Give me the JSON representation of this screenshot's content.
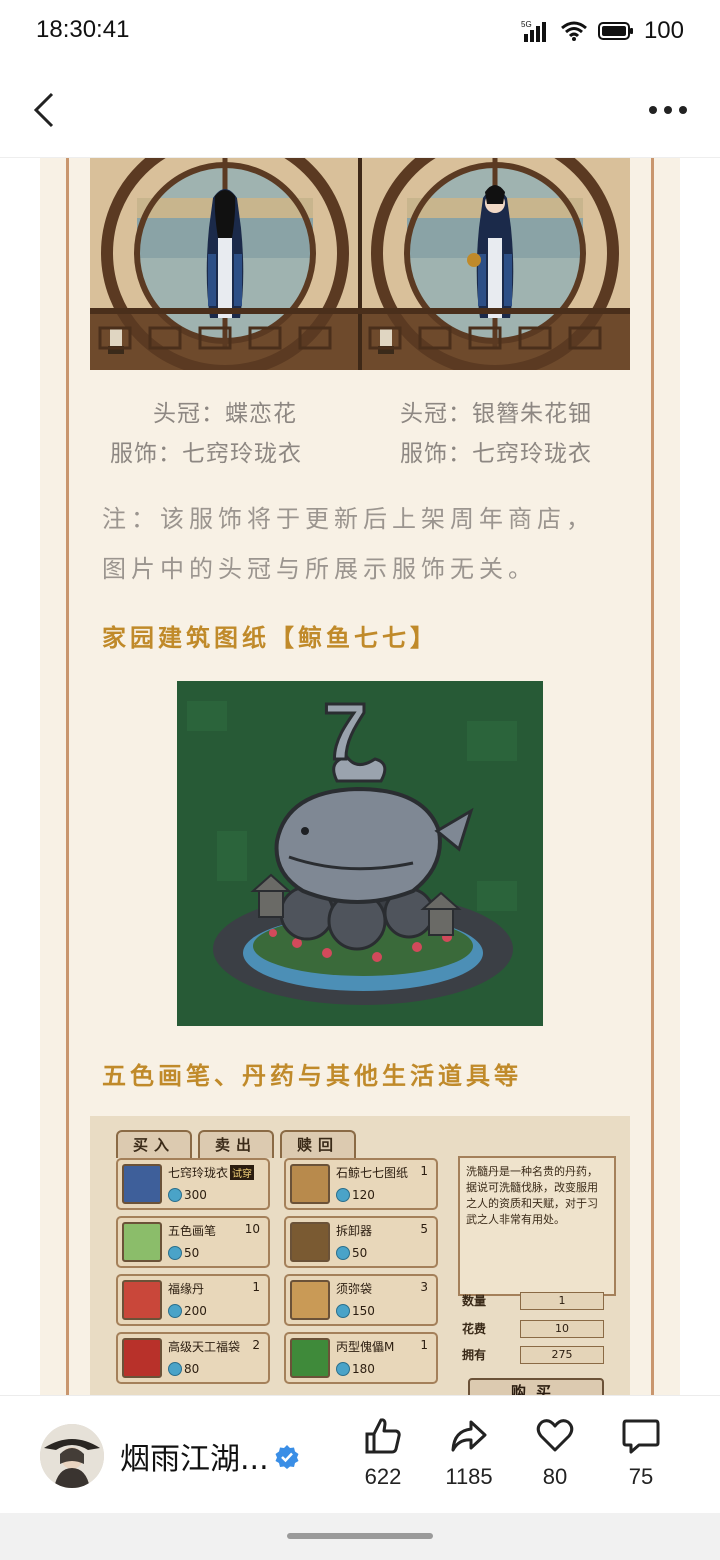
{
  "status_bar": {
    "time": "18:30:41",
    "network": "5G",
    "battery": "100"
  },
  "nav": {
    "back_icon": "chevron-left-icon",
    "more_icon": "more-horizontal-icon"
  },
  "article": {
    "outfit_captions": {
      "left": {
        "crown": "头冠：蝶恋花",
        "outfit": "服饰：七窍玲珑衣"
      },
      "right": {
        "crown": "头冠：银簪朱花钿",
        "outfit": "服饰：七窍玲珑衣"
      }
    },
    "note": "注：该服饰将于更新后上架周年商店，图片中的头冠与所展示服饰无关。",
    "section1_title": "家园建筑图纸【鲸鱼七七】",
    "whale_label": "7",
    "section2_title": "五色画笔、丹药与其他生活道具等",
    "shop": {
      "tabs": [
        "买入",
        "卖出",
        "赎回"
      ],
      "items": [
        {
          "name": "七窍玲珑衣",
          "badge": "试穿",
          "qty": "",
          "price": "300"
        },
        {
          "name": "石鲸七七图纸",
          "badge": "",
          "qty": "1",
          "price": "120"
        },
        {
          "name": "五色画笔",
          "badge": "",
          "qty": "10",
          "price": "50"
        },
        {
          "name": "拆卸器",
          "badge": "",
          "qty": "5",
          "price": "50"
        },
        {
          "name": "福缘丹",
          "badge": "",
          "qty": "1",
          "price": "200"
        },
        {
          "name": "须弥袋",
          "badge": "",
          "qty": "3",
          "price": "150"
        },
        {
          "name": "高级天工福袋",
          "badge": "",
          "qty": "2",
          "price": "80"
        },
        {
          "name": "丙型傀儡M",
          "badge": "",
          "qty": "1",
          "price": "180"
        }
      ],
      "description": "洗髓丹是一种名贵的丹药，据说可洗髓伐脉，改变服用之人的资质和天赋，对于习武之人非常有用处。",
      "quantity_label": "数量",
      "quantity_value": "1",
      "cost_label": "花费",
      "cost_value": "10",
      "own_label": "拥有",
      "own_value": "275",
      "buy_label": "购买"
    }
  },
  "footer": {
    "author": "烟雨江湖...",
    "likes": "622",
    "shares": "1185",
    "favorites": "80",
    "comments": "75"
  },
  "colors": {
    "accent_title": "#c08a2a",
    "parchment": "#f8f1e5",
    "frame": "#c9966e",
    "verified": "#3a8ee6"
  }
}
